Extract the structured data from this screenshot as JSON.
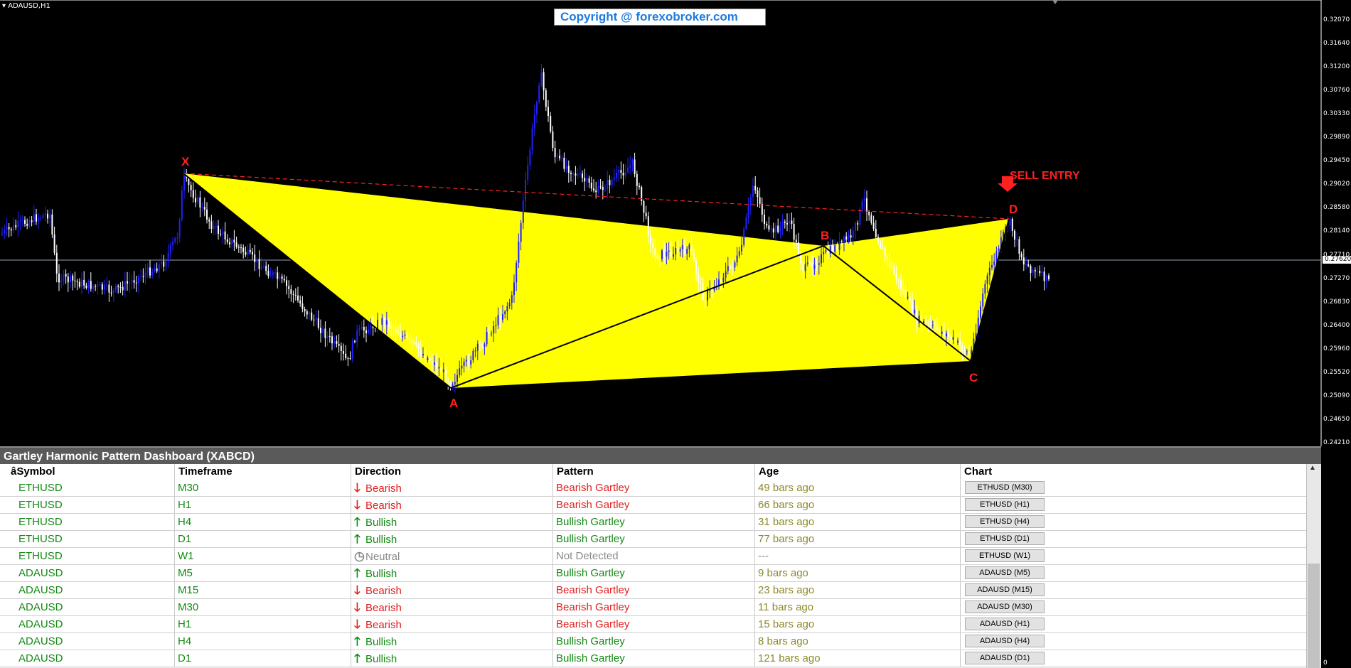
{
  "chart": {
    "symbol_title": "ADAUSD,H1",
    "copyright": "Copyright @ forexobroker.com",
    "price_axis": [
      "0.32070",
      "0.31640",
      "0.31200",
      "0.30760",
      "0.30330",
      "0.29890",
      "0.29450",
      "0.29020",
      "0.28580",
      "0.28140",
      "0.27710",
      "0.27270",
      "0.26830",
      "0.26400",
      "0.25960",
      "0.25520",
      "0.25090",
      "0.24650",
      "0.24210"
    ],
    "current_price": "0.27620",
    "points": {
      "X": "X",
      "A": "A",
      "B": "B",
      "C": "C",
      "D": "D"
    },
    "sell_entry": "SELL ENTRY",
    "fill_color": "#ffff00",
    "bull_candle_color": "#2020ff",
    "bear_candle_color": "#ffffff"
  },
  "dashboard": {
    "title": "Gartley Harmonic Pattern Dashboard (XABCD)",
    "headers": {
      "symbol": "âSymbol",
      "timeframe": "Timeframe",
      "direction": "Direction",
      "pattern": "Pattern",
      "age": "Age",
      "chart": "Chart"
    },
    "rows": [
      {
        "symbol": "ETHUSD",
        "timeframe": "M30",
        "direction": "Bearish",
        "pattern": "Bearish Gartley",
        "age": "49 bars ago",
        "chart": "ETHUSD (M30)"
      },
      {
        "symbol": "ETHUSD",
        "timeframe": "H1",
        "direction": "Bearish",
        "pattern": "Bearish Gartley",
        "age": "66 bars ago",
        "chart": "ETHUSD (H1)"
      },
      {
        "symbol": "ETHUSD",
        "timeframe": "H4",
        "direction": "Bullish",
        "pattern": "Bullish Gartley",
        "age": "31 bars ago",
        "chart": "ETHUSD (H4)"
      },
      {
        "symbol": "ETHUSD",
        "timeframe": "D1",
        "direction": "Bullish",
        "pattern": "Bullish Gartley",
        "age": "77 bars ago",
        "chart": "ETHUSD (D1)"
      },
      {
        "symbol": "ETHUSD",
        "timeframe": "W1",
        "direction": "Neutral",
        "pattern": "Not Detected",
        "age": "---",
        "chart": "ETHUSD (W1)"
      },
      {
        "symbol": "ADAUSD",
        "timeframe": "M5",
        "direction": "Bullish",
        "pattern": "Bullish Gartley",
        "age": "9 bars ago",
        "chart": "ADAUSD (M5)"
      },
      {
        "symbol": "ADAUSD",
        "timeframe": "M15",
        "direction": "Bearish",
        "pattern": "Bearish Gartley",
        "age": "23 bars ago",
        "chart": "ADAUSD (M15)"
      },
      {
        "symbol": "ADAUSD",
        "timeframe": "M30",
        "direction": "Bearish",
        "pattern": "Bearish Gartley",
        "age": "11 bars ago",
        "chart": "ADAUSD (M30)"
      },
      {
        "symbol": "ADAUSD",
        "timeframe": "H1",
        "direction": "Bearish",
        "pattern": "Bearish Gartley",
        "age": "15 bars ago",
        "chart": "ADAUSD (H1)"
      },
      {
        "symbol": "ADAUSD",
        "timeframe": "H4",
        "direction": "Bullish",
        "pattern": "Bullish Gartley",
        "age": "8 bars ago",
        "chart": "ADAUSD (H4)"
      },
      {
        "symbol": "ADAUSD",
        "timeframe": "D1",
        "direction": "Bullish",
        "pattern": "Bullish Gartley",
        "age": "121 bars ago",
        "chart": "ADAUSD (D1)"
      }
    ],
    "colors": {
      "bullish": "#138a13",
      "bearish": "#e02020",
      "neutral": "#8a8a8a",
      "age": "#8c8a2a"
    }
  },
  "right_axis_bottom": "0"
}
